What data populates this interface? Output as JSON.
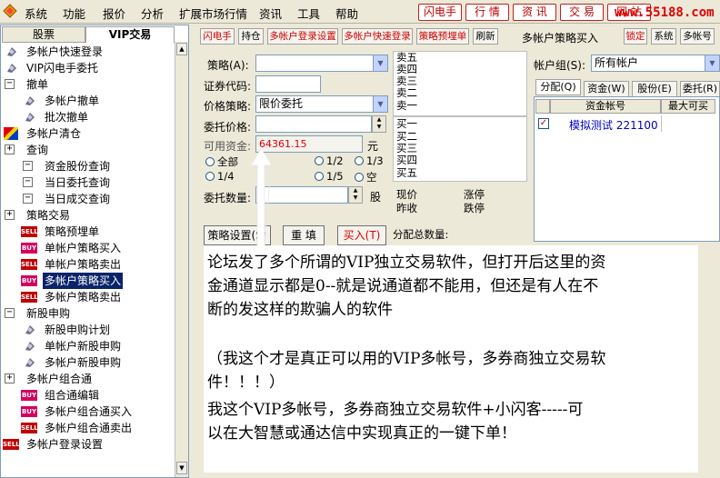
{
  "menu": [
    "系统",
    "功能",
    "报价",
    "分析",
    "扩展市场行情",
    "资讯",
    "工具",
    "帮助"
  ],
  "top_buttons": [
    "闪电手",
    "行 情",
    "资 讯",
    "交 易",
    "网 站"
  ],
  "site_url": "www.55188.com",
  "left_tabs": [
    "股票",
    "VIP交易"
  ],
  "tree": [
    {
      "label": "多帐户快速登录",
      "icon": "gear"
    },
    {
      "label": "VIP闪电手委托",
      "icon": "gear"
    },
    {
      "label": "撤单",
      "icon": "minus"
    },
    {
      "label": "多帐户撤单",
      "icon": "gear"
    },
    {
      "label": "批次撤单",
      "icon": "gear"
    },
    {
      "label": "多帐户清仓",
      "icon": "color"
    },
    {
      "label": "查询",
      "icon": "plus"
    },
    {
      "label": "资金股份查询",
      "icon": "box"
    },
    {
      "label": "当日委托查询",
      "icon": "box"
    },
    {
      "label": "当日成交查询",
      "icon": "box"
    },
    {
      "label": "策略交易",
      "icon": "plus"
    },
    {
      "label": "策略预埋单",
      "icon": "sell"
    },
    {
      "label": "单帐户策略买入",
      "icon": "buy"
    },
    {
      "label": "单帐户策略卖出",
      "icon": "sell"
    },
    {
      "label": "多帐户策略买入",
      "icon": "buy"
    },
    {
      "label": "多帐户策略卖出",
      "icon": "sell"
    },
    {
      "label": "新股申购",
      "icon": "minus"
    },
    {
      "label": "新股申购计划",
      "icon": "gear"
    },
    {
      "label": "单帐户新股申购",
      "icon": "gear"
    },
    {
      "label": "多帐户新股申购",
      "icon": "gear"
    },
    {
      "label": "多帐户组合通",
      "icon": "plus"
    },
    {
      "label": "组合通编辑",
      "icon": "buy"
    },
    {
      "label": "多帐户组合通买入",
      "icon": "buy"
    },
    {
      "label": "多帐户组合通卖出",
      "icon": "sell"
    },
    {
      "label": "多帐户登录设置",
      "icon": "sell"
    }
  ],
  "icon_text": {
    "sell": "SELL",
    "buy": "BUY"
  },
  "toolbar": [
    "闪电手",
    "持仓",
    "多帐户登录设置",
    "多帐户快速登录",
    "策略预埋单",
    "刷新"
  ],
  "window_title": "多帐户策略买入",
  "toolbar_right": [
    "锁定",
    "系统",
    "多帐号"
  ],
  "form": {
    "strategy_label": "策略(A):",
    "code_label": "证券代码:",
    "price_strategy_label": "价格策略:",
    "price_strategy_value": "限价委托",
    "price_label": "委托价格:",
    "funds_label": "可用资金:",
    "funds_value": "64361.15",
    "funds_unit": "元",
    "ratios": [
      "全部",
      "1/2",
      "1/3",
      "1/4",
      "1/5",
      "空"
    ],
    "qty_label": "委托数量:",
    "qty_unit": "股"
  },
  "buttons": {
    "strategy_settings": "策略设置(S)",
    "refill": "重 填",
    "buy": "买入(T)"
  },
  "quotes": {
    "sell": [
      "卖五",
      "卖四",
      "卖三",
      "卖二",
      "卖一"
    ],
    "buy": [
      "买一",
      "买二",
      "买三",
      "买四",
      "买五"
    ],
    "current": "现价",
    "prev_close": "昨收",
    "limit_up": "涨停",
    "limit_down": "跌停"
  },
  "alloc_total_label": "分配总数量:",
  "account_group_label": "帐户组(S):",
  "account_group_value": "所有帐户",
  "right_tabs": [
    "分配(Q)",
    "资金(W)",
    "股份(E)",
    "委托(R)"
  ],
  "account_table": {
    "headers": [
      "资金帐号",
      "最大可买"
    ],
    "rows": [
      [
        "模拟测试 221100",
        ""
      ]
    ]
  },
  "overlay_text": [
    "论坛发了多个所谓的VIP独立交易软件，但打开后这里的资",
    "金通道显示都是0--就是说通道都不能用，但还是有人在不",
    "断的发这样的欺骗人的软件",
    "（我这个才是真正可以用的VIP多帐号，多券商独立交易软",
    "件！！！）",
    "我这个VIP多帐号，多券商独立交易软件+小闪客-----可",
    "以在大智慧或通达信中实现真正的一键下单！"
  ]
}
